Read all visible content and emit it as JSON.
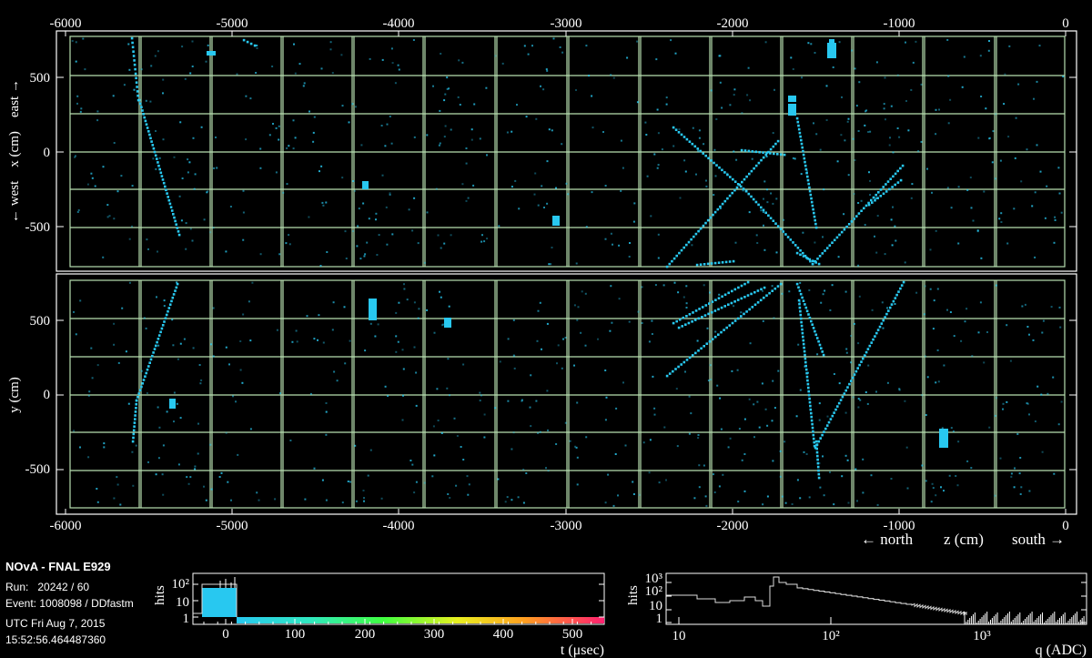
{
  "detector_axes": {
    "z_ticks": [
      "-6000",
      "-5000",
      "-4000",
      "-3000",
      "-2000",
      "-1000",
      "0"
    ],
    "x_ticks": [
      "500",
      "0",
      "-500"
    ],
    "y_ticks": [
      "500",
      "0",
      "-500"
    ],
    "xz_ylabel": "← west    x (cm)    east →",
    "yz_ylabel": "y (cm)",
    "z_label_north": "← north",
    "z_label_z": "z (cm)",
    "z_label_south": "south →"
  },
  "event_info": {
    "title": "NOvA - FNAL E929",
    "run": "Run:   20242 / 60",
    "event": "Event: 1008098 / DDfastm",
    "date": "UTC Fri Aug 7, 2015",
    "time": "15:52:56.464487360"
  },
  "time_hist": {
    "ylabel": "hits",
    "y_ticks": [
      "10²",
      "10",
      "1"
    ],
    "x_ticks": [
      "0",
      "100",
      "200",
      "300",
      "400",
      "500"
    ],
    "xlabel": "t (μsec)"
  },
  "charge_hist": {
    "ylabel": "hits",
    "y_ticks": [
      "10³",
      "10²",
      "10",
      "1"
    ],
    "x_ticks": [
      "10",
      "10²",
      "10³"
    ],
    "xlabel": "q (ADC)"
  },
  "colors": {
    "background": "#000000",
    "grid": "#b8e0b0",
    "hit": "#28c8f0",
    "frame": "#ffffff"
  }
}
